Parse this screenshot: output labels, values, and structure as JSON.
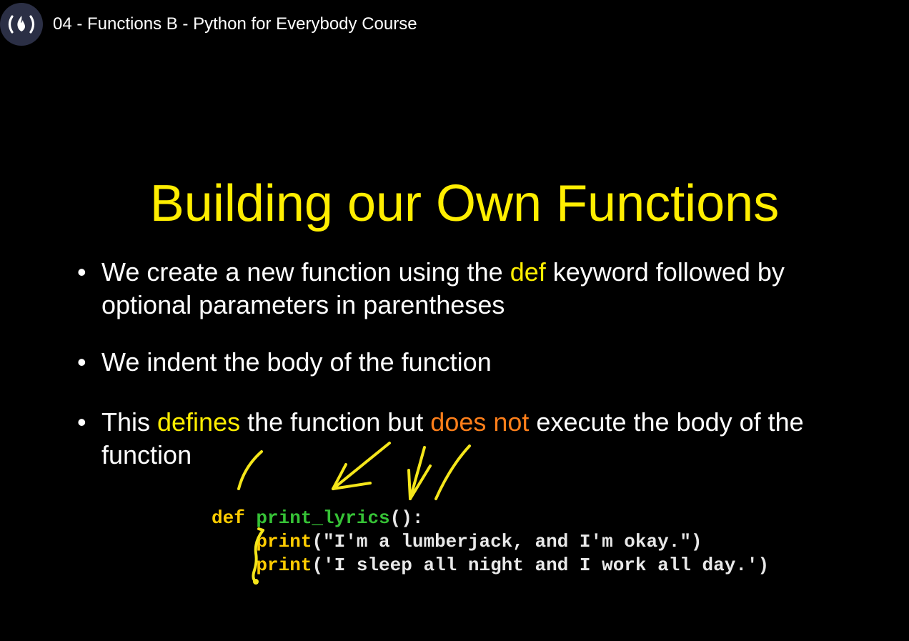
{
  "video": {
    "title": "04 - Functions B - Python for Everybody Course",
    "channel_icon": "freecodecamp-logo-icon"
  },
  "slide": {
    "title": "Building our Own Functions",
    "bullets": [
      {
        "parts": [
          "We create a new function using the ",
          "def",
          " keyword followed by optional parameters in parentheses"
        ]
      },
      {
        "parts": [
          "We indent the body of the function"
        ]
      },
      {
        "parts": [
          "This ",
          "defines",
          " the function but ",
          "does not",
          " execute the body of the function"
        ]
      }
    ],
    "bullet_symbol": "•",
    "code": {
      "line1_kw": "def",
      "line1_fn": "print_lyrics",
      "line1_rest": "():",
      "line2_indent": "    ",
      "line2_fn": "print",
      "line2_rest": "(\"I'm a lumberjack, and I'm okay.\")",
      "line3_indent": "    ",
      "line3_fn": "print",
      "line3_rest": "('I sleep all night and I work all day.')"
    }
  },
  "colors": {
    "background": "#000000",
    "title": "#ffee00",
    "highlight_yellow": "#ffee00",
    "highlight_orange": "#ff7f1a",
    "code_keyword": "#ffcc00",
    "code_function_name": "#36c236",
    "annotation_ink": "#f5e61a"
  }
}
